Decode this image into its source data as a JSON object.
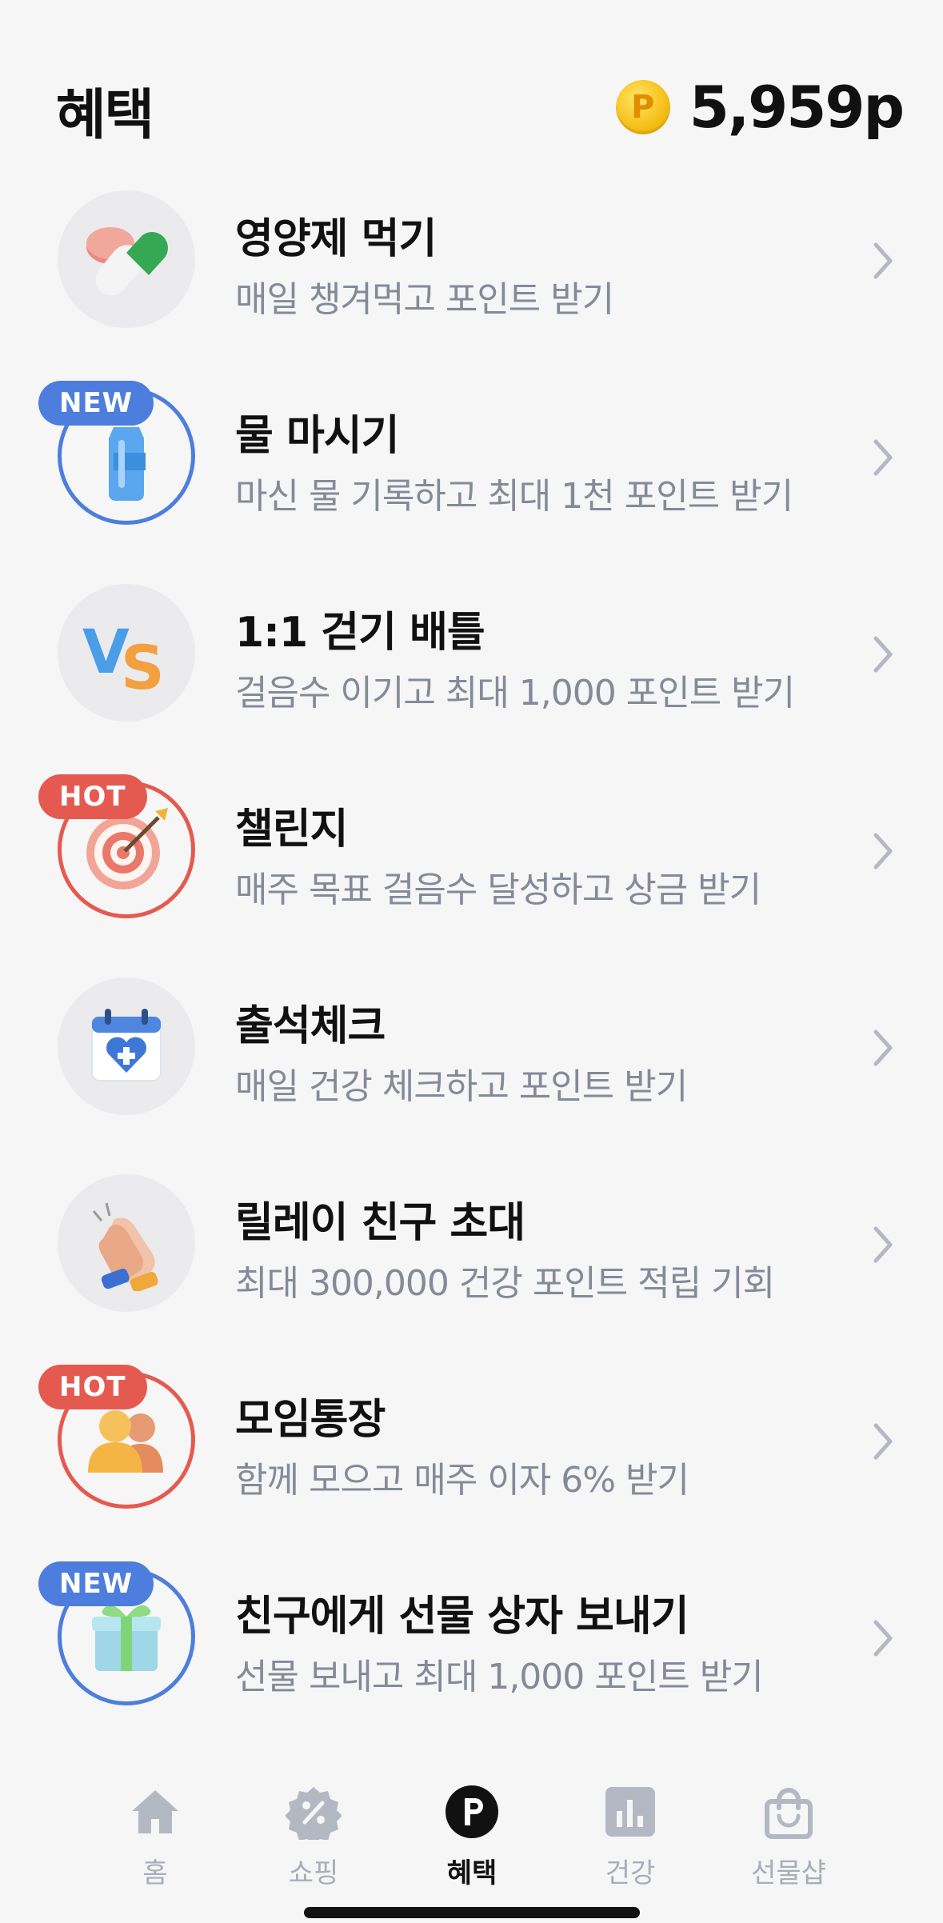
{
  "header": {
    "title": "혜택",
    "points": "5,959p",
    "coin_symbol": "P"
  },
  "items": [
    {
      "title": "영양제 먹기",
      "subtitle": "매일 챙겨먹고 포인트 받기",
      "badge": "",
      "icon": "pill-icon"
    },
    {
      "title": "물 마시기",
      "subtitle": "마신 물 기록하고 최대 1천 포인트 받기",
      "badge": "NEW",
      "icon": "water-bottle-icon"
    },
    {
      "title": "1:1 걷기 배틀",
      "subtitle": "걸음수 이기고 최대 1,000 포인트 받기",
      "badge": "",
      "icon": "vs-icon"
    },
    {
      "title": "챌린지",
      "subtitle": "매주 목표 걸음수 달성하고 상금 받기",
      "badge": "HOT",
      "icon": "target-icon"
    },
    {
      "title": "출석체크",
      "subtitle": "매일 건강 체크하고 포인트 받기",
      "badge": "",
      "icon": "calendar-heart-icon"
    },
    {
      "title": "릴레이 친구 초대",
      "subtitle": "최대 300,000 건강 포인트 적립 기회",
      "badge": "",
      "icon": "clapping-hands-icon"
    },
    {
      "title": "모임통장",
      "subtitle": "함께 모으고 매주 이자 6% 받기",
      "badge": "HOT",
      "icon": "people-icon"
    },
    {
      "title": "친구에게 선물 상자 보내기",
      "subtitle": "선물 보내고 최대 1,000 포인트 받기",
      "badge": "NEW",
      "icon": "gift-box-icon"
    }
  ],
  "tabs": [
    {
      "label": "홈",
      "icon": "home-icon",
      "active": false
    },
    {
      "label": "쇼핑",
      "icon": "discount-icon",
      "active": false
    },
    {
      "label": "혜택",
      "icon": "points-icon",
      "active": true
    },
    {
      "label": "건강",
      "icon": "chart-icon",
      "active": false
    },
    {
      "label": "선물샵",
      "icon": "shopping-bag-icon",
      "active": false
    }
  ],
  "colors": {
    "badge_new": "#4d7ddd",
    "badge_hot": "#e55a50",
    "subtitle": "#858a98",
    "tab_inactive": "#a9adb8",
    "background": "#f6f6f7"
  }
}
